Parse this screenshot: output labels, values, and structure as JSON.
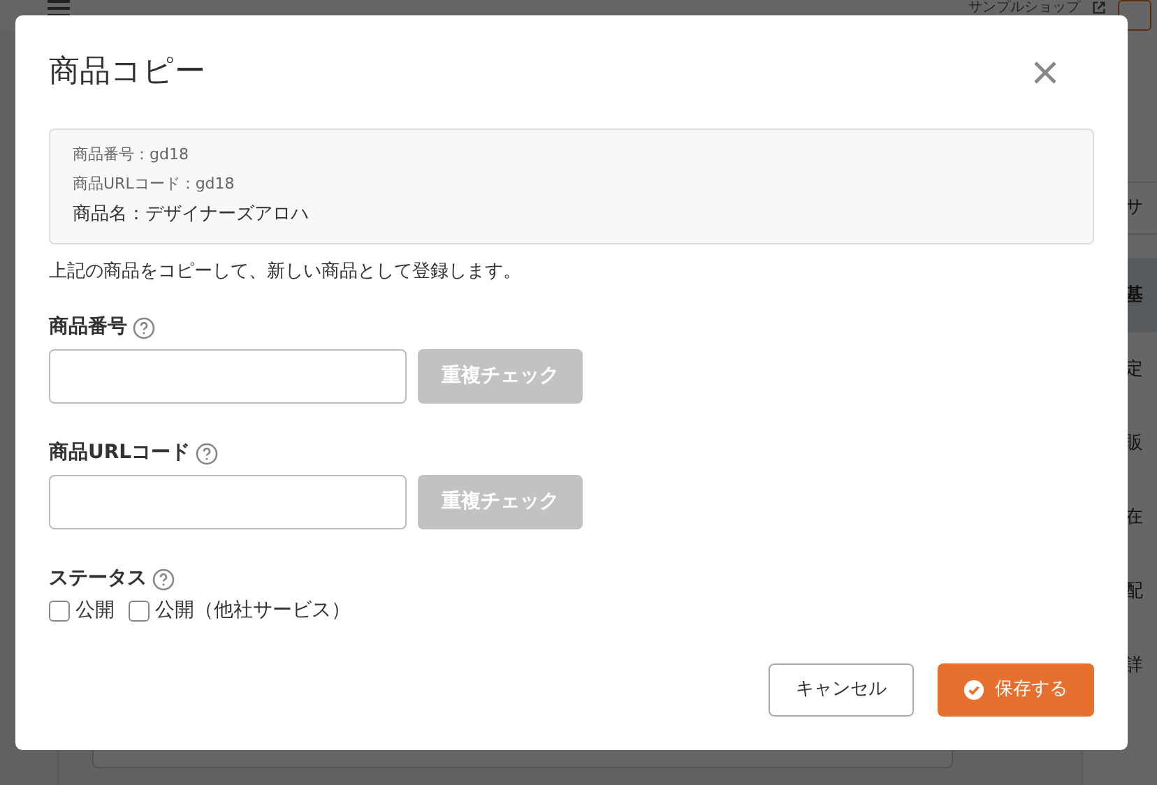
{
  "page": {
    "shop_link": "サンプルショップ",
    "side_tabs": [
      {
        "label": "サ",
        "selected": false,
        "kind": "header"
      },
      {
        "label": "基",
        "selected": true,
        "kind": "tab"
      },
      {
        "label": "定",
        "selected": false,
        "kind": "tab"
      },
      {
        "label": "販",
        "selected": false,
        "kind": "tab"
      },
      {
        "label": "在",
        "selected": false,
        "kind": "tab"
      },
      {
        "label": "配",
        "selected": false,
        "kind": "tab"
      },
      {
        "label": "詳",
        "selected": false,
        "kind": "tab"
      }
    ]
  },
  "dialog": {
    "title": "商品コピー",
    "info_lines": [
      {
        "text": "商品番号：gd18",
        "kind": "meta"
      },
      {
        "text": "商品URLコード：gd18",
        "kind": "meta"
      },
      {
        "text": "商品名：デザイナーズアロハ",
        "kind": "name"
      }
    ],
    "description": "上記の商品をコピーして、新しい商品として登録します。",
    "fields": [
      {
        "label": "商品番号",
        "kind": "text",
        "button": {
          "label": "重複チェック",
          "disabled": true
        }
      },
      {
        "label": "商品URLコード",
        "kind": "text",
        "button": {
          "label": "重複チェック",
          "disabled": true
        }
      },
      {
        "label": "ステータス",
        "kind": "checkboxes",
        "options": [
          {
            "label": "公開",
            "checked": false
          },
          {
            "label": "公開（他社サービス）",
            "checked": false
          }
        ]
      }
    ],
    "buttons": [
      {
        "label": "キャンセル",
        "kind": "secondary"
      },
      {
        "label": "保存する",
        "kind": "primary"
      }
    ]
  }
}
